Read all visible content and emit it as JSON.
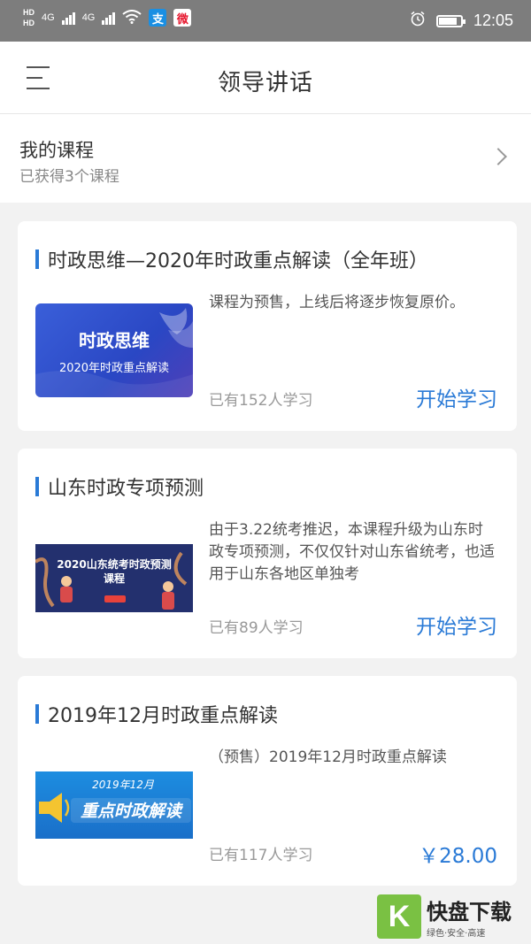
{
  "status_bar": {
    "hd_top": "HD",
    "hd_bottom": "HD",
    "net1": "4G",
    "net2": "4G",
    "alipay_glyph": "支",
    "weibo_glyph": "微",
    "time": "12:05",
    "battery_level": 0.85,
    "icons": [
      "signal-icon",
      "wifi-icon",
      "alipay-icon",
      "weibo-icon",
      "alarm-icon",
      "battery-icon"
    ]
  },
  "header": {
    "title": "领导讲话",
    "menu_icon": "menu-icon"
  },
  "my_courses": {
    "title": "我的课程",
    "subtitle": "已获得3个课程"
  },
  "courses": [
    {
      "title": "时政思维—2020年时政重点解读（全年班）",
      "thumb_title": "时政思维",
      "thumb_sub": "2020年时政重点解读",
      "description": "课程为预售，上线后将逐步恢复原价。",
      "learners": "已有152人学习",
      "action": "开始学习"
    },
    {
      "title": "山东时政专项预测",
      "thumb_title": "2020山东统考时政预测",
      "thumb_sub": "课程",
      "description": "由于3.22统考推迟，本课程升级为山东时政专项预测，不仅仅针对山东省统考，也适用于山东各地区单独考",
      "learners": "已有89人学习",
      "action": "开始学习"
    },
    {
      "title": "2019年12月时政重点解读",
      "thumb_title": "2019年12月",
      "thumb_sub": "重点时政解读",
      "description": "（预售）2019年12月时政重点解读",
      "learners": "已有117人学习",
      "price": "￥28.00"
    }
  ],
  "watermark": {
    "logo_char": "K",
    "main": "快盘下载",
    "sub": "绿色·安全·高速"
  },
  "colors": {
    "accent": "#2a7ad6",
    "status_bar": "#7d7d7d",
    "background": "#f2f2f2"
  }
}
